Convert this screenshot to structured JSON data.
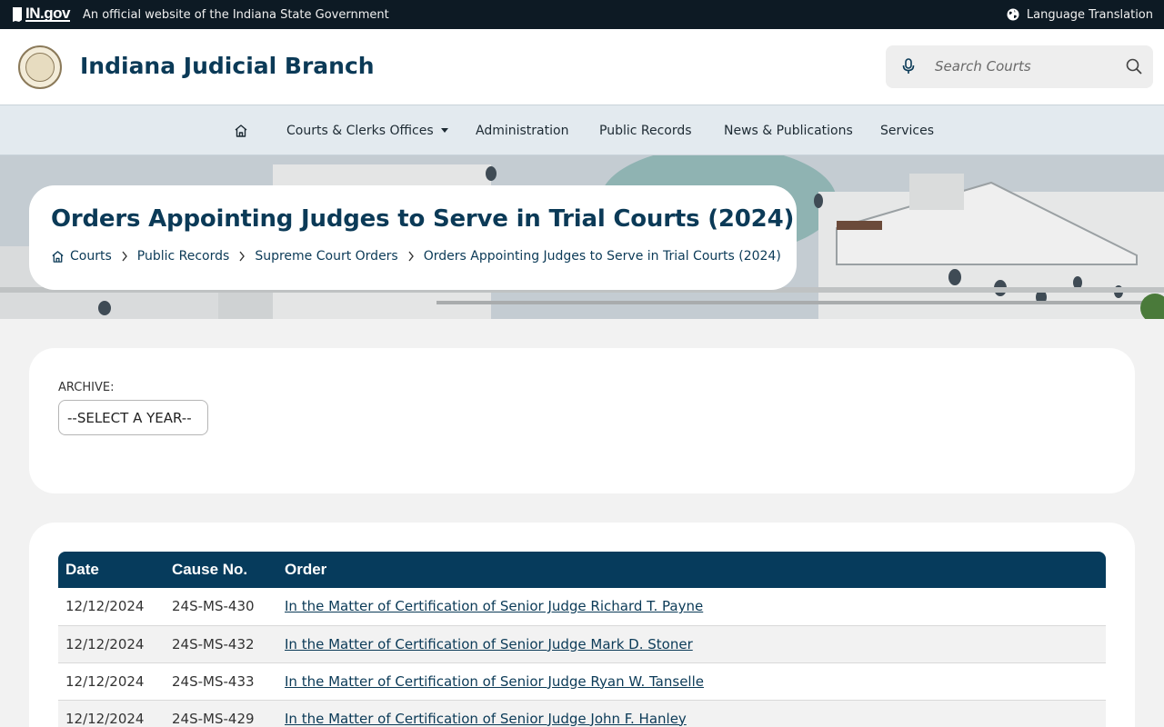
{
  "gov_bar": {
    "logo_text": "IN.gov",
    "tagline": "An official website of the Indiana State Government",
    "language_link": "Language Translation",
    "language_icon": "globe-icon"
  },
  "header": {
    "site_title": "Indiana Judicial Branch",
    "seal_icon": "state-seal-icon",
    "search_placeholder": "Search Courts",
    "mic_icon": "microphone-icon",
    "search_icon": "magnifier-icon"
  },
  "nav": {
    "home_icon": "home-icon",
    "items": [
      {
        "label": "Courts & Clerks Offices",
        "has_dropdown": true
      },
      {
        "label": "Administration"
      },
      {
        "label": "Public Records"
      },
      {
        "label": "News & Publications"
      },
      {
        "label": "Services"
      }
    ]
  },
  "page": {
    "title": "Orders Appointing Judges to Serve in Trial Courts (2024)",
    "breadcrumb": [
      "Courts",
      "Public Records",
      "Supreme Court Orders",
      "Orders Appointing Judges to Serve in Trial Courts (2024)"
    ]
  },
  "archive": {
    "label": "ARCHIVE:",
    "select_value": "--SELECT A YEAR--"
  },
  "orders_table": {
    "headers": [
      "Date",
      "Cause No.",
      "Order"
    ],
    "rows": [
      {
        "date": "12/12/2024",
        "cause": "24S-MS-430",
        "order": "In the Matter of Certification of Senior Judge Richard T. Payne"
      },
      {
        "date": "12/12/2024",
        "cause": "24S-MS-432",
        "order": "In the Matter of Certification of Senior Judge Mark D. Stoner"
      },
      {
        "date": "12/12/2024",
        "cause": "24S-MS-433",
        "order": "In the Matter of Certification of Senior Judge Ryan W. Tanselle"
      },
      {
        "date": "12/12/2024",
        "cause": "24S-MS-429",
        "order": "In the Matter of Certification of Senior Judge John F. Hanley"
      }
    ]
  },
  "colors": {
    "brand_navy": "#0b3a57",
    "table_header": "#063b5c",
    "gov_bar": "#0d1a24",
    "nav_bg": "#e3eaef"
  }
}
